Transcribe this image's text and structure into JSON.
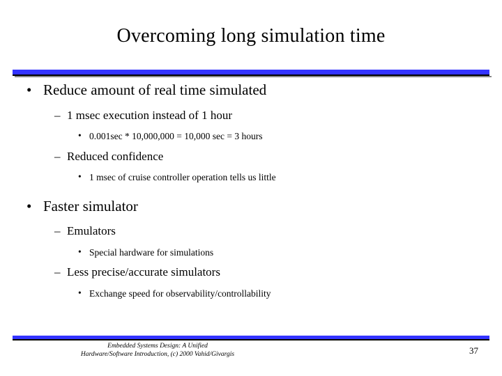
{
  "slide": {
    "title": "Overcoming long simulation time",
    "bullets": [
      {
        "level": 1,
        "marker": "•",
        "text": "Reduce amount of real time simulated"
      },
      {
        "level": 2,
        "marker": "–",
        "text": "1 msec execution instead of 1 hour"
      },
      {
        "level": 3,
        "marker": "•",
        "text": "0.001sec * 10,000,000 = 10,000 sec = 3 hours"
      },
      {
        "level": 2,
        "marker": "–",
        "text": "Reduced confidence"
      },
      {
        "level": 3,
        "marker": "•",
        "text": "1 msec of cruise controller operation tells us little"
      },
      {
        "level": 1,
        "marker": "•",
        "text": "Faster simulator"
      },
      {
        "level": 2,
        "marker": "–",
        "text": "Emulators"
      },
      {
        "level": 3,
        "marker": "•",
        "text": "Special hardware for simulations"
      },
      {
        "level": 2,
        "marker": "–",
        "text": "Less precise/accurate simulators"
      },
      {
        "level": 3,
        "marker": "•",
        "text": "Exchange speed for observability/controllability"
      }
    ],
    "footer": {
      "line1": "Embedded Systems Design: A Unified",
      "line2": "Hardware/Software Introduction, (c) 2000 Vahid/Givargis"
    },
    "page_number": "37",
    "accent_color": "#3333ff"
  }
}
